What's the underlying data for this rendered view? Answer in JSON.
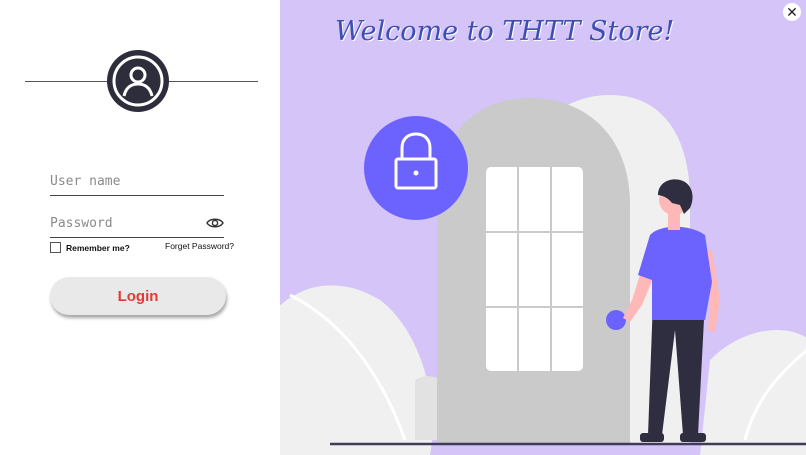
{
  "login": {
    "username_placeholder": "User name",
    "password_placeholder": "Password",
    "remember_label": "Remember me?",
    "forget_label": "Forget Password?",
    "login_label": "Login"
  },
  "banner": {
    "title": "Welcome to THTT Store!",
    "close_label": "✕"
  },
  "icons": {
    "avatar": "user-circle-icon",
    "eye": "eye-icon",
    "lock": "lock-icon",
    "close": "close-icon"
  },
  "colors": {
    "panel_bg": "#d4c4f8",
    "accent": "#6c63ff",
    "login_text": "#e53935",
    "title": "#3f4fb0"
  }
}
